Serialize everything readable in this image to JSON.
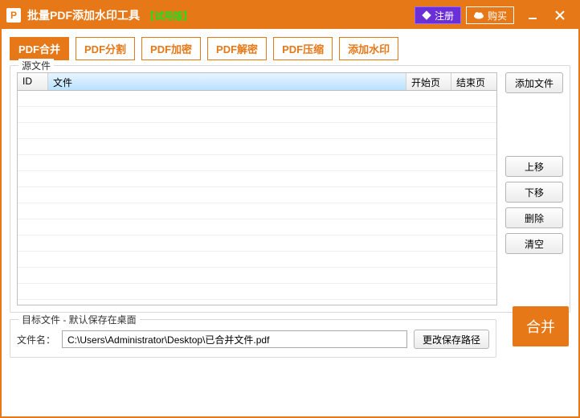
{
  "title": {
    "main": "批量PDF添加水印工具",
    "tag": "【试用版】",
    "app_icon_letter": "P"
  },
  "titlebar": {
    "register": "注册",
    "buy": "购买"
  },
  "tabs": [
    "PDF合并",
    "PDF分割",
    "PDF加密",
    "PDF解密",
    "PDF压缩",
    "添加水印"
  ],
  "src": {
    "group_label": "源文件",
    "columns": {
      "id": "ID",
      "file": "文件",
      "start": "开始页",
      "end": "结束页"
    },
    "buttons": {
      "add": "添加文件",
      "up": "上移",
      "down": "下移",
      "delete": "删除",
      "clear": "清空"
    }
  },
  "tgt": {
    "group_label": "目标文件 - 默认保存在桌面",
    "fn_label": "文件名：",
    "fn_value": "C:\\Users\\Administrator\\Desktop\\已合并文件.pdf",
    "change_path": "更改保存路径"
  },
  "merge_label": "合并"
}
